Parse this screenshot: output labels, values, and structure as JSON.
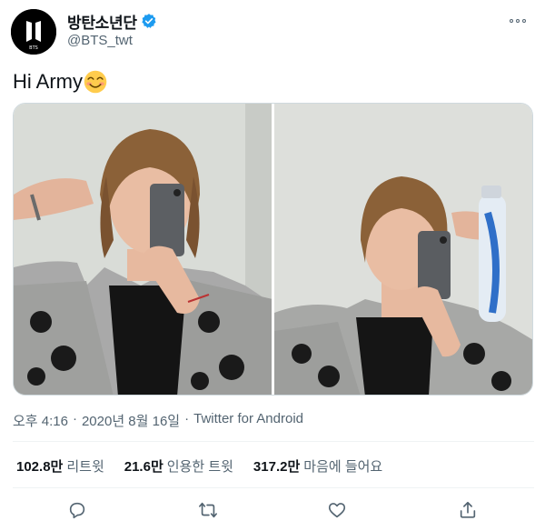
{
  "author": {
    "display_name": "방탄소년단",
    "handle": "@BTS_twt",
    "verified": true,
    "avatar_logo_text": "BTS"
  },
  "tweet": {
    "text": "Hi Army",
    "emoji": "smiling-face-with-smiling-eyes"
  },
  "media": {
    "photos": [
      {
        "description_icon": "mirror-selfie-photo-1"
      },
      {
        "description_icon": "mirror-selfie-photo-2"
      }
    ]
  },
  "meta": {
    "time": "오후 4:16",
    "date": "2020년 8월 16일",
    "separator": "·",
    "source": "Twitter for Android"
  },
  "stats": {
    "retweets_count": "102.8만",
    "retweets_label": "리트윗",
    "quotes_count": "21.6만",
    "quotes_label": "인용한 트윗",
    "likes_count": "317.2만",
    "likes_label": "마음에 들어요"
  },
  "actions": [
    {
      "icon": "reply-icon"
    },
    {
      "icon": "retweet-icon"
    },
    {
      "icon": "like-icon"
    },
    {
      "icon": "share-icon"
    }
  ],
  "colors": {
    "verified_blue": "#1d9bf0",
    "secondary_text": "#536471",
    "primary_text": "#0f1419"
  }
}
